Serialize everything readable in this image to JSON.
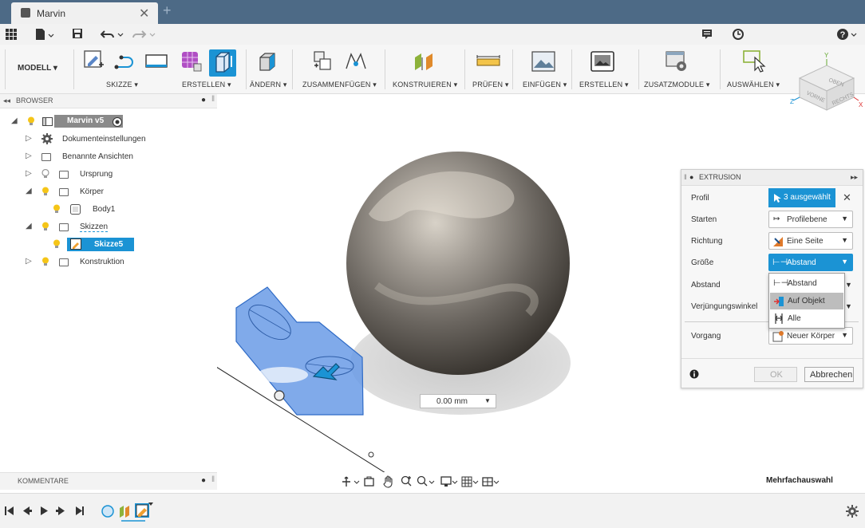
{
  "window": {
    "tab_title": "Marvin",
    "tab_close": "✕",
    "new_tab": "+"
  },
  "quick_access": {
    "help": "?"
  },
  "ribbon": {
    "workspace": "MODELL ▾",
    "groups": [
      "SKIZZE ▾",
      "ERSTELLEN ▾",
      "ÄNDERN ▾",
      "ZUSAMMENFÜGEN ▾",
      "KONSTRUIEREN ▾",
      "PRÜFEN ▾",
      "EINFÜGEN ▾",
      "ERSTELLEN ▾",
      "ZUSATZMODULE ▾",
      "AUSWÄHLEN ▾"
    ]
  },
  "viewcube": {
    "top": "OBEN",
    "front": "VORNE",
    "right": "RECHTS",
    "axis_x": "X",
    "axis_y": "Y",
    "axis_z": "Z"
  },
  "browser": {
    "title": "BROWSER",
    "root": "Marvin v5",
    "items": [
      {
        "label": "Dokumenteinstellungen"
      },
      {
        "label": "Benannte Ansichten"
      },
      {
        "label": "Ursprung"
      },
      {
        "label": "Körper"
      },
      {
        "label": "Body1"
      },
      {
        "label": "Skizzen"
      },
      {
        "label": "Skizze5"
      },
      {
        "label": "Konstruktion"
      }
    ]
  },
  "extrusion": {
    "title": "EXTRUSION",
    "rows": [
      {
        "label": "Profil",
        "value": "3 ausgewählt"
      },
      {
        "label": "Starten",
        "value": "Profilebene"
      },
      {
        "label": "Richtung",
        "value": "Eine Seite"
      },
      {
        "label": "Größe",
        "value": "Abstand"
      },
      {
        "label": "Abstand",
        "value": ""
      },
      {
        "label": "Verjüngungswinkel",
        "value": ""
      },
      {
        "label": "Vorgang",
        "value": "Neuer Körper"
      }
    ],
    "dropdown_options": [
      "Abstand",
      "Auf Objekt",
      "Alle"
    ],
    "ok": "OK",
    "cancel": "Abbrechen",
    "close": "✕"
  },
  "viewport": {
    "distance_value": "0.00 mm"
  },
  "comments": {
    "title": "KOMMENTARE"
  },
  "status": {
    "mode": "Mehrfachauswahl"
  },
  "colors": {
    "accent": "#1b93d4",
    "titlebar": "#4d6a86",
    "selection_blue": "#6a9be6"
  }
}
